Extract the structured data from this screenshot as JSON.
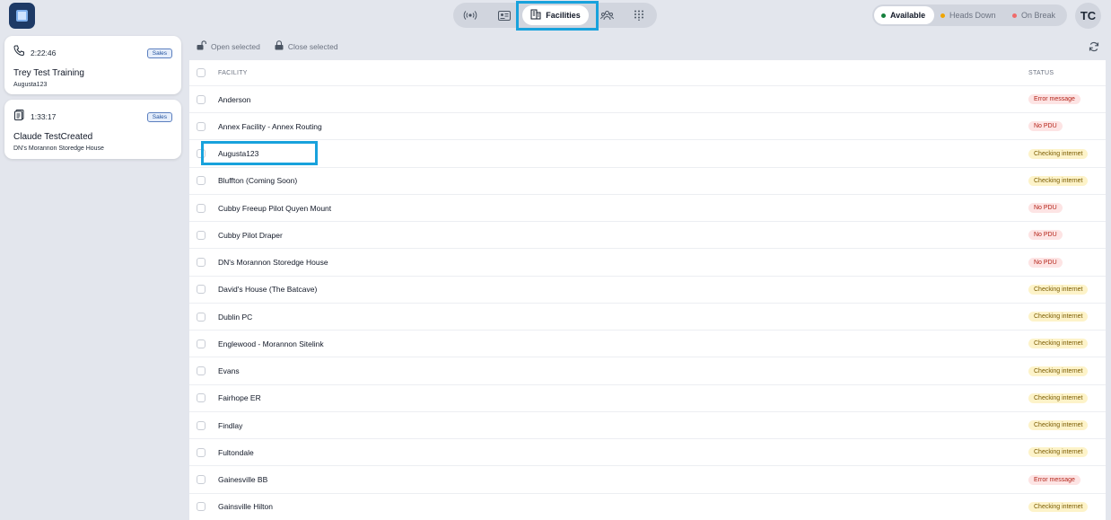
{
  "nav": {
    "active_label": "Facilities",
    "icons": [
      "broadcast-icon",
      "contact-card-icon",
      "building-icon",
      "team-icon",
      "dialpad-icon"
    ]
  },
  "presence": {
    "available": "Available",
    "heads_down": "Heads Down",
    "on_break": "On Break",
    "colors": {
      "available": "#15803d",
      "heads_down": "#f0a500",
      "on_break": "#ef6b6b"
    }
  },
  "user": {
    "initials": "TC"
  },
  "cards": [
    {
      "time": "2:22:46",
      "badge": "Sales",
      "title": "Trey Test Training",
      "subtitle": "Augusta123",
      "icon": "phone-icon"
    },
    {
      "time": "1:33:17",
      "badge": "Sales",
      "title": "Claude TestCreated",
      "subtitle": "DN's Morannon Storedge House",
      "icon": "clipboard-icon"
    }
  ],
  "toolbar": {
    "open_selected": "Open selected",
    "close_selected": "Close selected"
  },
  "table": {
    "headers": {
      "facility": "FACILITY",
      "status": "STATUS"
    },
    "rows": [
      {
        "facility": "Anderson",
        "status": "Error message",
        "tone": "red"
      },
      {
        "facility": "Annex Facility - Annex Routing",
        "status": "No PDU",
        "tone": "red"
      },
      {
        "facility": "Augusta123",
        "status": "Checking internet",
        "tone": "yellow"
      },
      {
        "facility": "Bluffton (Coming Soon)",
        "status": "Checking internet",
        "tone": "yellow"
      },
      {
        "facility": "Cubby Freeup Pilot Quyen Mount",
        "status": "No PDU",
        "tone": "red"
      },
      {
        "facility": "Cubby Pilot Draper",
        "status": "No PDU",
        "tone": "red"
      },
      {
        "facility": "DN's Morannon Storedge House",
        "status": "No PDU",
        "tone": "red"
      },
      {
        "facility": "David's House (The Batcave)",
        "status": "Checking internet",
        "tone": "yellow"
      },
      {
        "facility": "Dublin PC",
        "status": "Checking internet",
        "tone": "yellow"
      },
      {
        "facility": "Englewood - Morannon Sitelink",
        "status": "Checking internet",
        "tone": "yellow"
      },
      {
        "facility": "Evans",
        "status": "Checking internet",
        "tone": "yellow"
      },
      {
        "facility": "Fairhope ER",
        "status": "Checking internet",
        "tone": "yellow"
      },
      {
        "facility": "Findlay",
        "status": "Checking internet",
        "tone": "yellow"
      },
      {
        "facility": "Fultondale",
        "status": "Checking internet",
        "tone": "yellow"
      },
      {
        "facility": "Gainesville BB",
        "status": "Error message",
        "tone": "red"
      },
      {
        "facility": "Gainsville Hilton",
        "status": "Checking internet",
        "tone": "yellow"
      }
    ]
  }
}
